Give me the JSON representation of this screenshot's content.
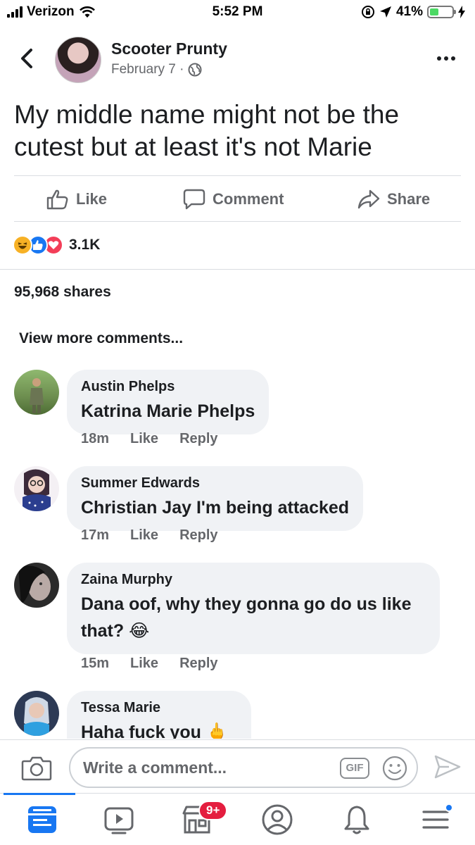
{
  "status_bar": {
    "carrier": "Verizon",
    "time": "5:52 PM",
    "battery": "41%",
    "battery_level": 0.41
  },
  "post": {
    "author": "Scooter Prunty",
    "date": "February 7 ·",
    "text": "My middle name might not be the cutest but at least it's not Marie",
    "actions": {
      "like": "Like",
      "comment": "Comment",
      "share": "Share"
    },
    "reaction_count": "3.1K",
    "shares": "95,968 shares",
    "view_more": "View more comments..."
  },
  "comments": [
    {
      "name": "Austin Phelps",
      "text": "Katrina Marie Phelps",
      "time": "18m",
      "like": "Like",
      "reply": "Reply"
    },
    {
      "name": "Summer Edwards",
      "text": "Christian Jay I'm being attacked",
      "time": "17m",
      "like": "Like",
      "reply": "Reply"
    },
    {
      "name": "Zaina Murphy",
      "text": "Dana oof, why they gonna go do us like that?",
      "emoji": "😂",
      "time": "15m",
      "like": "Like",
      "reply": "Reply"
    },
    {
      "name": "Tessa Marie",
      "text": "Haha fuck you 🖕"
    }
  ],
  "composer": {
    "placeholder": "Write a comment...",
    "gif_label": "GIF"
  },
  "tabbar": {
    "marketplace_badge": "9+"
  },
  "colors": {
    "accent": "#1877f2",
    "badge": "#e41e3f",
    "bubble": "#f0f2f5",
    "secondary_text": "#65676b"
  }
}
